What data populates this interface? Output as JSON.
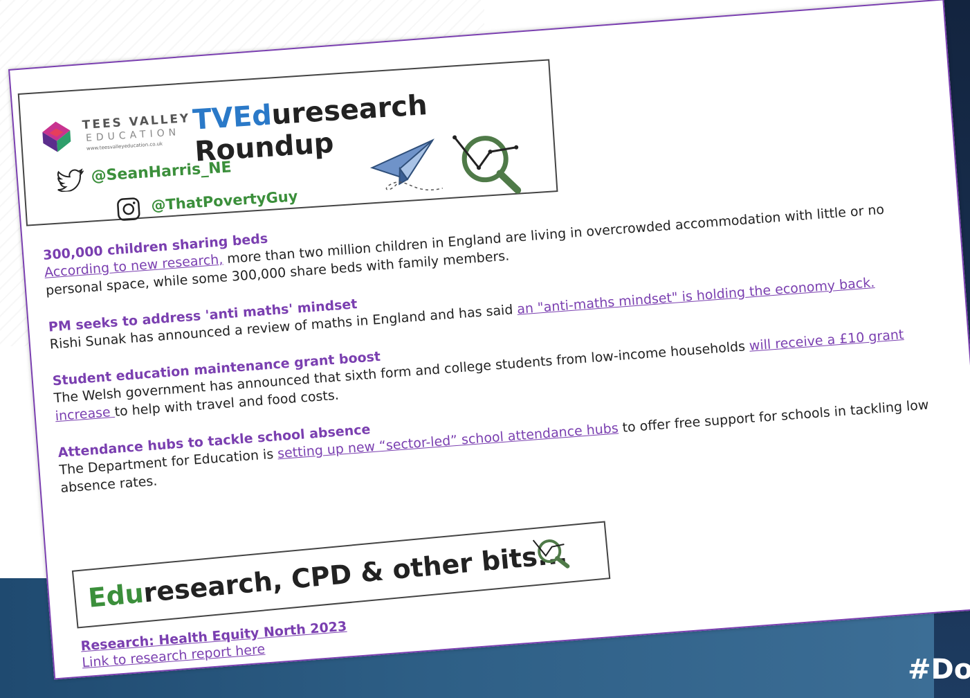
{
  "banner": {
    "brand_line1": "TEES VALLEY",
    "brand_line2": "EDUCATION",
    "brand_url": "www.teesvalleyeducation.co.uk",
    "title_tv": "TVEd",
    "title_rest": "uresearch Roundup",
    "twitter_handle": "@SeanHarris_NE",
    "instagram_handle": "@ThatPovertyGuy"
  },
  "news": [
    {
      "title": "300,000 children sharing beds",
      "link": "According to new research,",
      "body_after": " more than two million children in England are living in overcrowded accommodation with little or no personal space, while some 300,000 share beds with family members."
    },
    {
      "title": "PM seeks to address 'anti maths' mindset",
      "body_before": "Rishi Sunak has announced a review of maths in England and has said ",
      "link": "an \"anti-maths mindset\" is holding the economy back."
    },
    {
      "title": "Student education maintenance grant boost",
      "body_before": "The Welsh government has announced that sixth form and college students from low-income households ",
      "link": "will receive a £10 grant increase ",
      "body_after": "to help with travel and food costs."
    },
    {
      "title": "Attendance hubs to tackle school absence",
      "body_before": "The Department for Education is ",
      "link": "setting up new “sector-led” school attendance hubs",
      "body_after": " to offer free support for schools in tackling low absence rates."
    }
  ],
  "section": {
    "title_edu": "Edu",
    "title_rest": "research, CPD & other bits..."
  },
  "research": {
    "title": "Research: Health Equity North 2023",
    "link": "Link to research report here"
  },
  "hashtag": "#Do",
  "colors": {
    "link_purple": "#7a3fb0",
    "brand_blue": "#2a79c8",
    "brand_green": "#3b8f3b",
    "band_blue": "#2e5f86"
  },
  "icons": [
    "twitter-icon",
    "instagram-icon",
    "paper-plane-icon",
    "magnifier-chart-icon"
  ]
}
